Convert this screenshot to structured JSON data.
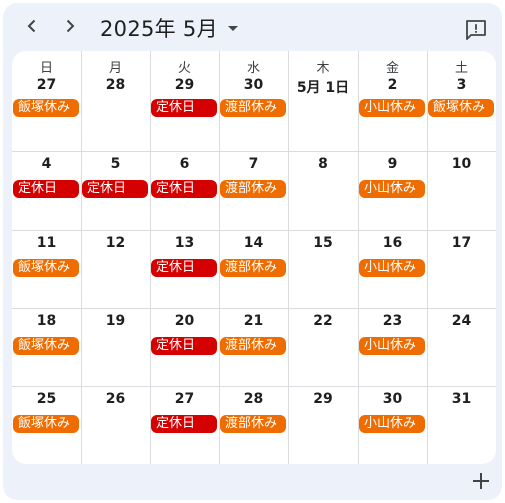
{
  "header": {
    "title": "2025年 5月",
    "prev_icon": "chevron-left-icon",
    "next_icon": "chevron-right-icon",
    "feedback_icon": "feedback-icon"
  },
  "colors": {
    "orange": "#ef6c00",
    "red": "#d50000",
    "panel": "#edf2fa"
  },
  "weekdays": [
    "日",
    "月",
    "火",
    "水",
    "木",
    "金",
    "土"
  ],
  "weeks": [
    [
      {
        "day": "27",
        "events": [
          {
            "label": "飯塚休み",
            "color": "orange"
          }
        ]
      },
      {
        "day": "28",
        "events": []
      },
      {
        "day": "29",
        "events": [
          {
            "label": "定休日",
            "color": "red"
          }
        ]
      },
      {
        "day": "30",
        "events": [
          {
            "label": "渡部休み",
            "color": "orange"
          }
        ]
      },
      {
        "day": "5月 1日",
        "events": []
      },
      {
        "day": "2",
        "events": [
          {
            "label": "小山休み",
            "color": "orange"
          }
        ]
      },
      {
        "day": "3",
        "events": [
          {
            "label": "飯塚休み",
            "color": "orange"
          }
        ]
      }
    ],
    [
      {
        "day": "4",
        "events": [
          {
            "label": "定休日",
            "color": "red"
          }
        ]
      },
      {
        "day": "5",
        "events": [
          {
            "label": "定休日",
            "color": "red"
          }
        ]
      },
      {
        "day": "6",
        "events": [
          {
            "label": "定休日",
            "color": "red"
          }
        ]
      },
      {
        "day": "7",
        "events": [
          {
            "label": "渡部休み",
            "color": "orange"
          }
        ]
      },
      {
        "day": "8",
        "events": []
      },
      {
        "day": "9",
        "events": [
          {
            "label": "小山休み",
            "color": "orange"
          }
        ]
      },
      {
        "day": "10",
        "events": []
      }
    ],
    [
      {
        "day": "11",
        "events": [
          {
            "label": "飯塚休み",
            "color": "orange"
          }
        ]
      },
      {
        "day": "12",
        "events": []
      },
      {
        "day": "13",
        "events": [
          {
            "label": "定休日",
            "color": "red"
          }
        ]
      },
      {
        "day": "14",
        "events": [
          {
            "label": "渡部休み",
            "color": "orange"
          }
        ]
      },
      {
        "day": "15",
        "events": []
      },
      {
        "day": "16",
        "events": [
          {
            "label": "小山休み",
            "color": "orange"
          }
        ]
      },
      {
        "day": "17",
        "events": []
      }
    ],
    [
      {
        "day": "18",
        "events": [
          {
            "label": "飯塚休み",
            "color": "orange"
          }
        ]
      },
      {
        "day": "19",
        "events": []
      },
      {
        "day": "20",
        "events": [
          {
            "label": "定休日",
            "color": "red"
          }
        ]
      },
      {
        "day": "21",
        "events": [
          {
            "label": "渡部休み",
            "color": "orange"
          }
        ]
      },
      {
        "day": "22",
        "events": []
      },
      {
        "day": "23",
        "events": [
          {
            "label": "小山休み",
            "color": "orange"
          }
        ]
      },
      {
        "day": "24",
        "events": []
      }
    ],
    [
      {
        "day": "25",
        "events": [
          {
            "label": "飯塚休み",
            "color": "orange"
          }
        ]
      },
      {
        "day": "26",
        "events": []
      },
      {
        "day": "27",
        "events": [
          {
            "label": "定休日",
            "color": "red"
          }
        ]
      },
      {
        "day": "28",
        "events": [
          {
            "label": "渡部休み",
            "color": "orange"
          }
        ]
      },
      {
        "day": "29",
        "events": []
      },
      {
        "day": "30",
        "events": [
          {
            "label": "小山休み",
            "color": "orange"
          }
        ]
      },
      {
        "day": "31",
        "events": []
      }
    ]
  ],
  "fab_icon": "plus-icon"
}
